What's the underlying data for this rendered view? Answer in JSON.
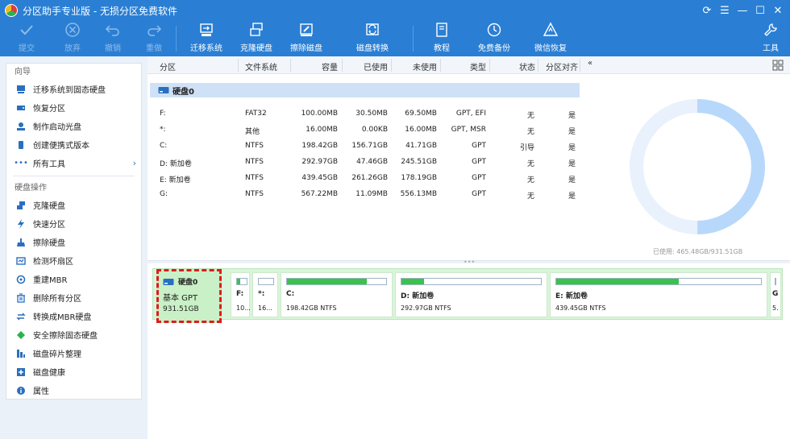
{
  "window": {
    "title": "分区助手专业版 - 无损分区免费软件"
  },
  "toolbar": {
    "items": [
      {
        "label": "提交",
        "icon": "check-icon",
        "disabled": true
      },
      {
        "label": "放弃",
        "icon": "close-circle-icon",
        "disabled": true
      },
      {
        "label": "撤销",
        "icon": "undo-icon",
        "disabled": true
      },
      {
        "label": "重做",
        "icon": "redo-icon",
        "disabled": true
      },
      {
        "label": "迁移系统",
        "icon": "migrate-os-icon",
        "disabled": false
      },
      {
        "label": "克隆硬盘",
        "icon": "clone-disk-icon",
        "disabled": false
      },
      {
        "label": "擦除磁盘",
        "icon": "wipe-disk-icon",
        "disabled": false
      },
      {
        "label": "磁盘转换",
        "icon": "disk-convert-icon",
        "disabled": false
      },
      {
        "label": "教程",
        "icon": "tutorial-icon",
        "disabled": false
      },
      {
        "label": "免费备份",
        "icon": "backup-icon",
        "disabled": false
      },
      {
        "label": "微信恢复",
        "icon": "recovery-icon",
        "disabled": false
      },
      {
        "label": "工具",
        "icon": "tools-icon",
        "disabled": false
      }
    ]
  },
  "sidebar": {
    "wizard_title": "向导",
    "wizard_items": [
      {
        "label": "迁移系统到固态硬盘",
        "icon": "migrate-icon"
      },
      {
        "label": "恢复分区",
        "icon": "restore-partition-icon"
      },
      {
        "label": "制作启动光盘",
        "icon": "bootable-media-icon"
      },
      {
        "label": "创建便携式版本",
        "icon": "portable-icon"
      },
      {
        "label": "所有工具",
        "icon": "more-icon"
      }
    ],
    "disk_ops_title": "硬盘操作",
    "disk_items": [
      {
        "label": "克隆硬盘",
        "icon": "clone-icon"
      },
      {
        "label": "快速分区",
        "icon": "quick-partition-icon"
      },
      {
        "label": "擦除硬盘",
        "icon": "wipe-icon"
      },
      {
        "label": "检测坏扇区",
        "icon": "bad-sector-icon"
      },
      {
        "label": "重建MBR",
        "icon": "rebuild-mbr-icon"
      },
      {
        "label": "删除所有分区",
        "icon": "delete-all-icon"
      },
      {
        "label": "转换成MBR硬盘",
        "icon": "convert-mbr-icon"
      },
      {
        "label": "安全擦除固态硬盘",
        "icon": "secure-erase-icon"
      },
      {
        "label": "磁盘碎片整理",
        "icon": "defrag-icon"
      },
      {
        "label": "磁盘健康",
        "icon": "disk-health-icon"
      },
      {
        "label": "属性",
        "icon": "info-icon"
      }
    ]
  },
  "table": {
    "headers": [
      "分区",
      "文件系统",
      "容量",
      "已使用",
      "未使用",
      "类型",
      "状态",
      "分区对齐"
    ],
    "disk_label": "硬盘0",
    "rows": [
      {
        "part": "F:",
        "fs": "FAT32",
        "cap": "100.00MB",
        "used": "30.50MB",
        "free": "69.50MB",
        "type": "GPT, EFI",
        "status": "无",
        "align": "是"
      },
      {
        "part": "*:",
        "fs": "其他",
        "cap": "16.00MB",
        "used": "0.00KB",
        "free": "16.00MB",
        "type": "GPT, MSR",
        "status": "无",
        "align": "是"
      },
      {
        "part": "C:",
        "fs": "NTFS",
        "cap": "198.42GB",
        "used": "156.71GB",
        "free": "41.71GB",
        "type": "GPT",
        "status": "引导",
        "align": "是"
      },
      {
        "part": "D: 新加卷",
        "fs": "NTFS",
        "cap": "292.97GB",
        "used": "47.46GB",
        "free": "245.51GB",
        "type": "GPT",
        "status": "无",
        "align": "是"
      },
      {
        "part": "E: 新加卷",
        "fs": "NTFS",
        "cap": "439.45GB",
        "used": "261.26GB",
        "free": "178.19GB",
        "type": "GPT",
        "status": "无",
        "align": "是"
      },
      {
        "part": "G:",
        "fs": "NTFS",
        "cap": "567.22MB",
        "used": "11.09MB",
        "free": "556.13MB",
        "type": "GPT",
        "status": "无",
        "align": "是"
      }
    ]
  },
  "usage": {
    "text": "已使用: 465.48GB/931.51GB",
    "used_fraction": 0.4997,
    "used_color": "#b8d8fb",
    "free_color": "#e8f1fc"
  },
  "diskmap": {
    "card": {
      "name": "硬盘0",
      "type": "基本 GPT",
      "size": "931.51GB"
    },
    "blocks": [
      {
        "name": "F:",
        "desc": "10...",
        "fill": 0.305
      },
      {
        "name": "*:",
        "desc": "16...",
        "fill": 0.0
      },
      {
        "name": "C:",
        "desc": "198.42GB NTFS",
        "fill": 0.79
      },
      {
        "name": "D: 新加卷",
        "desc": "292.97GB NTFS",
        "fill": 0.16
      },
      {
        "name": "E: 新加卷",
        "desc": "439.45GB NTFS",
        "fill": 0.595
      },
      {
        "name": "G",
        "desc": "5.",
        "fill": 0.02
      }
    ]
  }
}
